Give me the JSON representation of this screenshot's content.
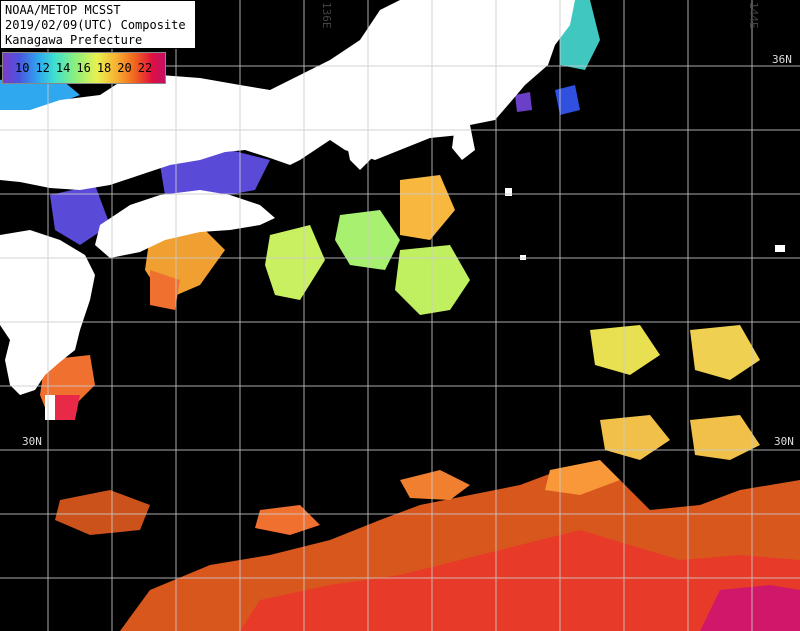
{
  "title": {
    "line1": "NOAA/METOP MCSST",
    "line2": "2019/02/09(UTC) Composite",
    "line3": "Kanagawa Prefecture"
  },
  "legend": {
    "ticks": [
      "10",
      "12",
      "14",
      "16",
      "18",
      "20",
      "22"
    ]
  },
  "grid_labels": {
    "lon_136": "136E",
    "lon_144": "144E",
    "lat_36_right": "36N",
    "lat_30_left": "30N",
    "lat_30_right": "30N"
  },
  "colors": {
    "ocean_nodata": "#000000",
    "land": "#ffffff",
    "grid": "#cccccc",
    "sst_10": "#7a3cc8",
    "sst_14": "#2fa8f0",
    "sst_16": "#8ff07a",
    "sst_18": "#e8f050",
    "sst_20": "#f06020",
    "sst_22": "#e01040"
  }
}
